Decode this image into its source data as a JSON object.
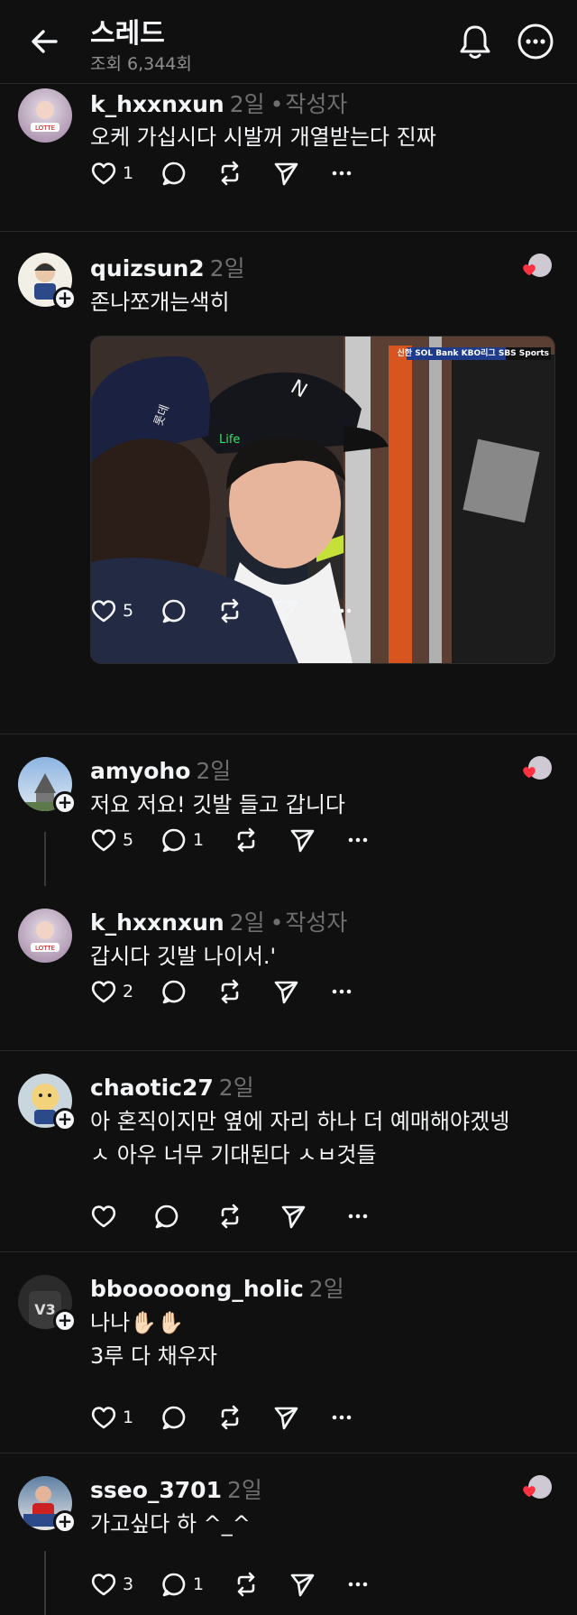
{
  "header": {
    "title": "스레드",
    "views": "조회 6,344회"
  },
  "posts": [
    {
      "username": "k_hxxnxun",
      "time": "2일",
      "author_tag": "작성자",
      "text": "오케 가십시다 시발꺼 개열받는다 진짜",
      "likes": "1",
      "replies": ""
    },
    {
      "username": "quizsun2",
      "time": "2일",
      "text": "존나쪼개는색히",
      "likes": "5",
      "replies": "",
      "image_caption": "신한 SOL Bank KBO리그  SBS Sports"
    },
    {
      "username": "amyoho",
      "time": "2일",
      "text": "저요 저요! 깃발 들고 갑니다",
      "likes": "5",
      "replies": "1"
    },
    {
      "username": "k_hxxnxun",
      "time": "2일",
      "author_tag": "작성자",
      "text": "갑시다 깃발 나이서.'",
      "likes": "2",
      "replies": ""
    },
    {
      "username": "chaotic27",
      "time": "2일",
      "text_lines": [
        "아 혼직이지만 옆에 자리 하나 더 예매해야겠넹",
        "ㅅ 아우 너무 기대된다 ㅅㅂ것들"
      ],
      "likes": "",
      "replies": ""
    },
    {
      "username": "bbooooong_holic",
      "time": "2일",
      "text_lines": [
        "나나✋🏻✋🏻",
        "3루 다 채우자"
      ],
      "likes": "1",
      "replies": ""
    },
    {
      "username": "sseo_3701",
      "time": "2일",
      "text": "가고싶다 하 ^_^",
      "likes": "3",
      "replies": "1"
    }
  ],
  "colors": {
    "background": "#101010",
    "text": "#f3f5f7",
    "muted": "#6f6f6f",
    "like_red": "#ff3040"
  }
}
